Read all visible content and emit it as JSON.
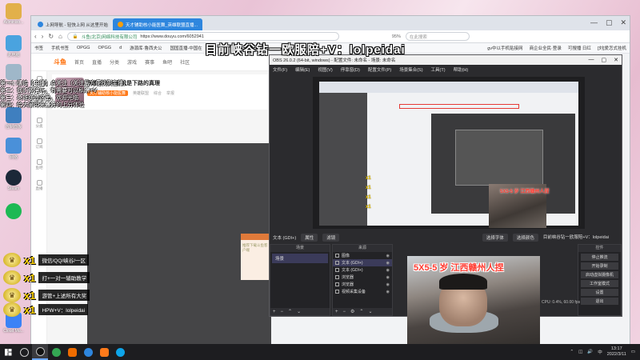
{
  "desktop": {
    "icons": [
      {
        "label": "Administr...",
        "color": "#e2b04a"
      },
      {
        "label": "此电脑",
        "color": "#4aa3df"
      },
      {
        "label": "回收站",
        "color": "#9fb7c9"
      },
      {
        "label": "控制面板",
        "color": "#3f7fbf"
      },
      {
        "label": "网络",
        "color": "#4a90d9"
      },
      {
        "label": "Steam",
        "color": "#1b2838"
      },
      {
        "label": "",
        "color": "#1db954"
      },
      {
        "label": "",
        "color": "#e0e0e0"
      },
      {
        "label": "",
        "color": "#ffd400"
      },
      {
        "label": "Cloud Mu...",
        "color": "#3b82f6"
      }
    ]
  },
  "browser": {
    "tabs": [
      {
        "label": "上网导航 - 轻快上网 从这里开始",
        "active": false
      },
      {
        "label": "天才辅助核小能医舞_英雄联盟直播...",
        "active": true
      }
    ],
    "window_controls": [
      "—",
      "▢",
      "✕"
    ],
    "url_site": "斗鱼(北京)网络科技有限公司",
    "url": "https://www.douyu.com/6052941",
    "zoom": "95%",
    "search_placeholder": "在此搜索",
    "bookmarks": [
      "书签",
      "手机书签",
      "OPGG",
      "OPGG",
      "d",
      "游源库·鲁西夫公",
      "国国直播-中国在"
    ],
    "bookmarks_right": [
      "gv中以手机贴接网",
      "商企业全民·登录",
      "可搜播 日红",
      "[刘]爱怎式挂机"
    ]
  },
  "douyu": {
    "logo": "斗鱼",
    "nav": [
      "首页",
      "直播",
      "分类",
      "游戏",
      "赛事",
      "鱼吧",
      "社区"
    ],
    "sidebar": [
      "推荐",
      "关注",
      "分类",
      "订阅",
      "鱼吧",
      "直播"
    ],
    "room_title": "所教学的内容就是下路的真理",
    "room_host": "天才辅助核小能医舞",
    "room_tags": [
      "英雄联盟",
      "综合",
      "举报"
    ],
    "dialog_text": "推荐下载斗鱼客户端"
  },
  "obs": {
    "title": "OBS 26.0.2 (64-bit, windows) - 配置文件: 未命名 - 场景: 未命名",
    "menu": [
      "文件(F)",
      "编辑(E)",
      "视图(V)",
      "停靠窗(D)",
      "配置文件(P)",
      "场景集合(S)",
      "工具(T)",
      "帮助(H)"
    ],
    "toolbar_source": "文本 (GDI+)",
    "toolbar_buttons": [
      "属性",
      "滤镜"
    ],
    "toolbar_right": [
      "选择字体",
      "选择颜色",
      "目前峡谷钻一欧服陪+V：lolpeidai"
    ],
    "docks": {
      "scenes": "场景",
      "sources": "来源",
      "mixer": "混音器",
      "transitions": "场景过渡",
      "controls": "控件"
    },
    "scenes": [
      "场景"
    ],
    "sources": [
      "图像",
      "文本 (GDI+)",
      "文本 (GDI+)",
      "浏览器",
      "浏览器",
      "视频采集设备"
    ],
    "controls": [
      "停止推流",
      "开始录制",
      "启动虚拟摄像机",
      "工作室模式",
      "设置",
      "退出"
    ],
    "status": "CPU: 0.4%, 60.00 fps",
    "preview_cam_text": "5X5-5 岁 江西赣州人捏"
  },
  "overlay": {
    "title": "目前峡谷钻一欧服陪+V：lolpeidai",
    "chat": [
      "第一：请给【主播】点关注（关注后方便找到主播）",
      "第二：我们做陪玩，有需要可以私聊+V",
      "第三：英雄联盟这里，欢迎光临",
      "第四：给大家带来最好的上分体验"
    ],
    "perks": [
      {
        "emblem": "♛",
        "count": "x1",
        "label": "微信/QQ/峡谷/一区"
      },
      {
        "emblem": "♛",
        "count": "x1",
        "label": "打+一对一辅助教学"
      },
      {
        "emblem": "♛",
        "count": "x1",
        "label": "游管+上述所有大奖"
      },
      {
        "emblem": "♛",
        "count": "x1",
        "label": "HPW+V：lolpeidai"
      }
    ],
    "cam_title": "5X5-5 岁 江西赣州人捏"
  },
  "taskbar": {
    "apps": [
      {
        "name": "obs-app",
        "color": "#2b2b2e",
        "active": true
      },
      {
        "name": "chrome-app",
        "color": "#34a853",
        "active": false
      },
      {
        "name": "g-app",
        "color": "#ef6c00",
        "active": false
      },
      {
        "name": "browser-app",
        "color": "#2e86de",
        "active": false
      },
      {
        "name": "douyu-app",
        "color": "#ff7a1a",
        "active": false
      },
      {
        "name": "edge-app",
        "color": "#0ea5e9",
        "active": false
      }
    ],
    "time": "13:17",
    "date": "2022/3/11"
  }
}
